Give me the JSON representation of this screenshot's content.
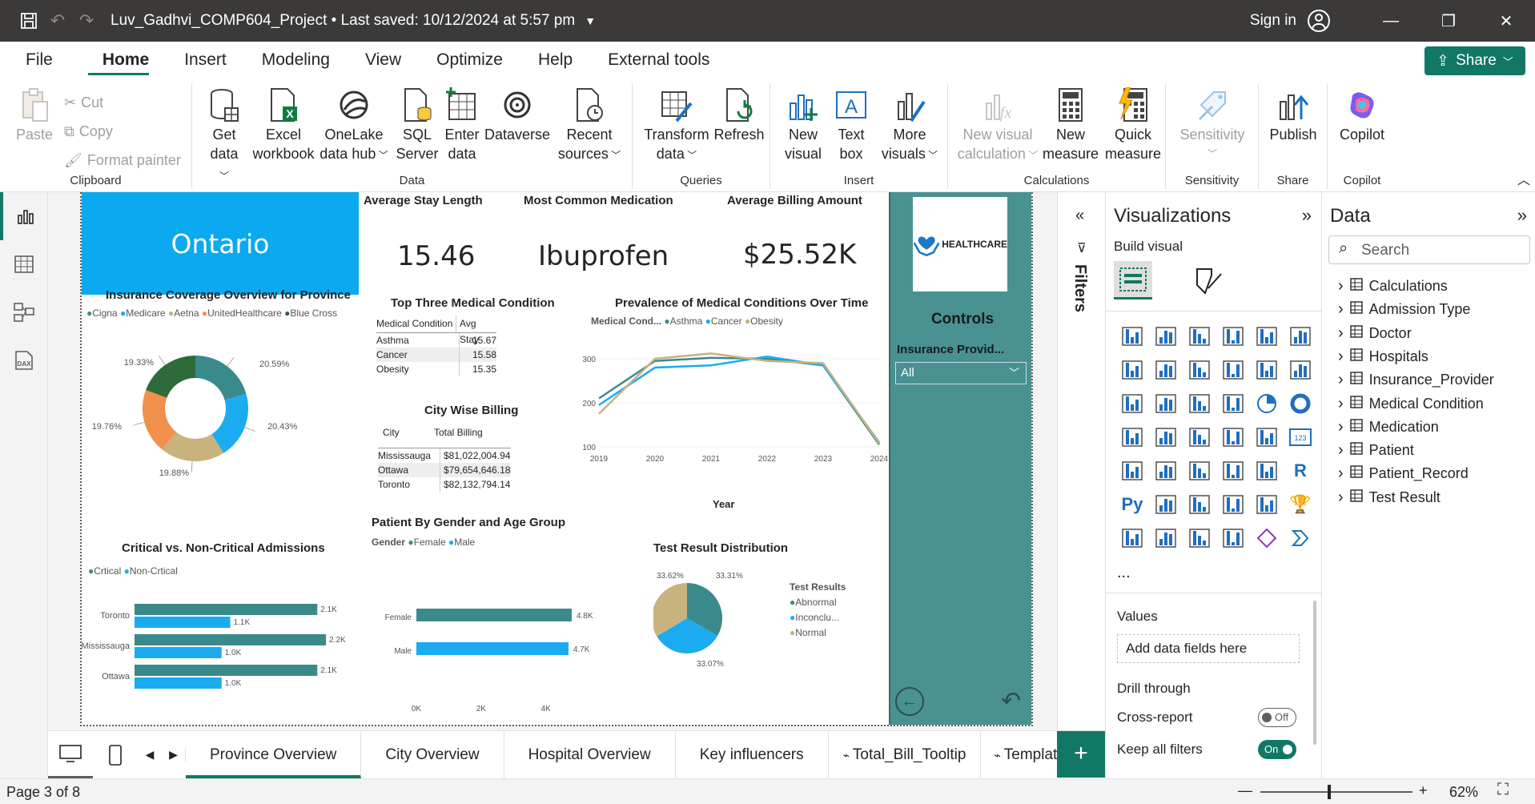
{
  "titlebar": {
    "title": "Luv_Gadhvi_COMP604_Project • Last saved: 10/12/2024 at 5:57 pm",
    "sign_in": "Sign in"
  },
  "menu": {
    "items": [
      "File",
      "Home",
      "Insert",
      "Modeling",
      "View",
      "Optimize",
      "Help",
      "External tools"
    ],
    "share": "Share"
  },
  "ribbon": {
    "clipboard": {
      "label": "Clipboard",
      "paste": "Paste",
      "cut": "Cut",
      "copy": "Copy",
      "format_painter": "Format painter"
    },
    "data": {
      "label": "Data",
      "get_data": [
        "Get",
        "data"
      ],
      "excel": [
        "Excel",
        "workbook"
      ],
      "onelake": [
        "OneLake",
        "data hub"
      ],
      "sql": [
        "SQL",
        "Server"
      ],
      "enter": [
        "Enter",
        "data"
      ],
      "dataverse": "Dataverse",
      "recent": [
        "Recent",
        "sources"
      ]
    },
    "queries": {
      "label": "Queries",
      "transform": [
        "Transform",
        "data"
      ],
      "refresh": "Refresh"
    },
    "insert": {
      "label": "Insert",
      "new_visual": [
        "New",
        "visual"
      ],
      "text_box": [
        "Text",
        "box"
      ],
      "more_visuals": [
        "More",
        "visuals"
      ]
    },
    "calculations": {
      "label": "Calculations",
      "new_visual_calc": [
        "New visual",
        "calculation"
      ],
      "new_measure": [
        "New",
        "measure"
      ],
      "quick_measure": [
        "Quick",
        "measure"
      ]
    },
    "sensitivity": {
      "label": "Sensitivity",
      "btn": "Sensitivity"
    },
    "share": {
      "label": "Share",
      "publish": "Publish"
    },
    "copilot": {
      "label": "Copilot",
      "btn": "Copilot"
    }
  },
  "report": {
    "province": "Ontario",
    "kpis": [
      {
        "label": "Average Stay Length",
        "value": "15.46"
      },
      {
        "label": "Most Common Medication",
        "value": "Ibuprofen"
      },
      {
        "label": "Average Billing Amount",
        "value": "$25.52K"
      }
    ],
    "logo_text": "HEALTHCARE",
    "controls": {
      "title": "Controls",
      "filter_label": "Insurance Provid...",
      "filter_value": "All"
    },
    "donut": {
      "title": "Insurance Coverage Overview for Province",
      "legend": [
        "Cigna",
        "Medicare",
        "Aetna",
        "UnitedHealthcare",
        "Blue Cross"
      ],
      "labels": [
        "20.59%",
        "20.43%",
        "19.88%",
        "19.76%",
        "19.33%"
      ]
    },
    "top3": {
      "title": "Top Three Medical Condition",
      "headers": [
        "Medical Condition",
        "Avg Stay"
      ],
      "rows": [
        [
          "Asthma",
          "15.67"
        ],
        [
          "Cancer",
          "15.58"
        ],
        [
          "Obesity",
          "15.35"
        ]
      ]
    },
    "city_billing": {
      "title": "City Wise Billing",
      "headers": [
        "City",
        "Total Billing"
      ],
      "rows": [
        [
          "Mississauga",
          "$81,022,004.94"
        ],
        [
          "Ottawa",
          "$79,654,646.18"
        ],
        [
          "Toronto",
          "$82,132,794.14"
        ]
      ]
    },
    "bars_critical": {
      "title": "Critical vs. Non-Critical Admissions",
      "legend": [
        "Crtical",
        "Non-Crtical"
      ]
    },
    "bars_gender": {
      "title": "Patient By Gender and Age Group",
      "legend_title": "Gender",
      "legend": [
        "Female",
        "Male"
      ]
    },
    "line": {
      "title": "Prevalence of Medical Conditions Over Time",
      "legend_title": "Medical Cond...",
      "legend": [
        "Asthma",
        "Cancer",
        "Obesity"
      ]
    },
    "pie": {
      "title": "Test Result Distribution",
      "legend_title": "Test Results",
      "legend": [
        "Abnormal",
        "Inconclu...",
        "Normal"
      ],
      "labels": [
        "33.31%",
        "33.07%",
        "33.62%"
      ]
    }
  },
  "chart_data": [
    {
      "type": "pie",
      "title": "Insurance Coverage Overview for Province",
      "categories": [
        "Cigna",
        "Medicare",
        "Aetna",
        "UnitedHealthcare",
        "Blue Cross"
      ],
      "values": [
        20.59,
        20.43,
        19.88,
        19.76,
        19.33
      ],
      "colors": [
        "#3a8a8c",
        "#1aabf0",
        "#c8b27e",
        "#f0904a",
        "#2e6b3a"
      ]
    },
    {
      "type": "bar",
      "title": "Critical vs. Non-Critical Admissions",
      "categories": [
        "Toronto",
        "Mississauga",
        "Ottawa"
      ],
      "series": [
        {
          "name": "Crtical",
          "values": [
            2.1,
            2.2,
            2.1
          ],
          "labels": [
            "2.1K",
            "2.2K",
            "2.1K"
          ],
          "color": "#3a8a8c"
        },
        {
          "name": "Non-Crtical",
          "values": [
            1.1,
            1.0,
            1.0
          ],
          "labels": [
            "1.1K",
            "1.0K",
            "1.0K"
          ],
          "color": "#1aabf0"
        }
      ],
      "xlim": [
        0,
        2.3
      ]
    },
    {
      "type": "bar",
      "title": "Patient By Gender and Age Group",
      "categories": [
        "Female",
        "Male"
      ],
      "series": [
        {
          "name": "Female",
          "values": [
            4.8
          ],
          "color": "#3a8a8c"
        },
        {
          "name": "Male",
          "values": [
            4.7
          ],
          "color": "#1aabf0"
        }
      ],
      "labels": [
        "4.8K",
        "4.7K"
      ],
      "xticks": [
        "0K",
        "2K",
        "4K"
      ],
      "xlim": [
        0,
        4
      ]
    },
    {
      "type": "line",
      "title": "Prevalence of Medical Conditions Over Time",
      "xlabel": "Year",
      "x": [
        2019,
        2020,
        2021,
        2022,
        2023,
        2024
      ],
      "ylim": [
        100,
        300
      ],
      "yticks": [
        100,
        200,
        300
      ],
      "series": [
        {
          "name": "Asthma",
          "values": [
            210,
            295,
            302,
            300,
            285,
            105
          ],
          "color": "#3a8a8c"
        },
        {
          "name": "Cancer",
          "values": [
            195,
            280,
            285,
            305,
            285,
            110
          ],
          "color": "#1aabf0"
        },
        {
          "name": "Obesity",
          "values": [
            175,
            300,
            312,
            295,
            290,
            108
          ],
          "color": "#c8b27e"
        }
      ]
    },
    {
      "type": "pie",
      "title": "Test Result Distribution",
      "categories": [
        "Abnormal",
        "Inconclu...",
        "Normal"
      ],
      "values": [
        33.31,
        33.07,
        33.62
      ],
      "colors": [
        "#3a8a8c",
        "#1aabf0",
        "#c8b27e"
      ]
    }
  ],
  "panes": {
    "filters": "Filters",
    "visualizations": {
      "title": "Visualizations",
      "build_visual": "Build visual",
      "values": "Values",
      "add_fields": "Add data fields here",
      "drill_through": "Drill through",
      "cross_report": "Cross-report",
      "cross_report_state": "Off",
      "keep_filters": "Keep all filters",
      "keep_filters_state": "On",
      "more": "..."
    },
    "data": {
      "title": "Data",
      "search_placeholder": "Search",
      "tables": [
        "Calculations",
        "Admission Type",
        "Doctor",
        "Hospitals",
        "Insurance_Provider",
        "Medical Condition",
        "Medication",
        "Patient",
        "Patient_Record",
        "Test Result"
      ]
    }
  },
  "tabs": [
    "Province Overview",
    "City Overview",
    "Hospital Overview",
    "Key influencers",
    "Total_Bill_Tooltip",
    "Template"
  ],
  "status": {
    "page": "Page 3 of 8",
    "zoom": "62%"
  },
  "colors": {
    "accent": "#117865",
    "teal": "#3a8a8c",
    "blue": "#1aabf0",
    "tan": "#c8b27e",
    "orange": "#f0904a",
    "darkgreen": "#2e6b3a",
    "panel": "#4a9191"
  }
}
